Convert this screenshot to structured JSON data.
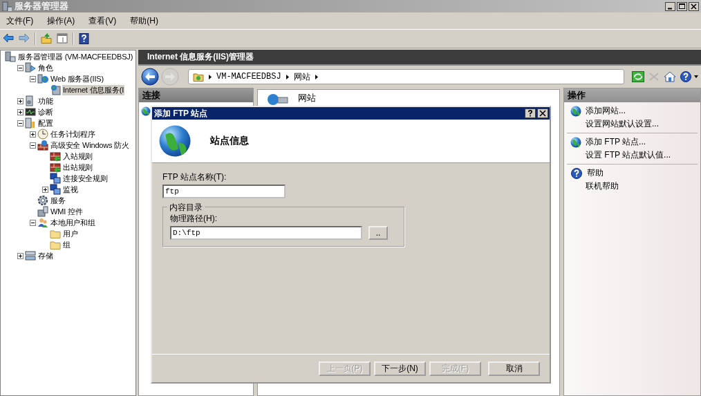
{
  "window": {
    "title": "服务器管理器"
  },
  "menu": [
    {
      "label": "文件(F)"
    },
    {
      "label": "操作(A)"
    },
    {
      "label": "查看(V)"
    },
    {
      "label": "帮助(H)"
    }
  ],
  "toolbar": [
    {
      "kind": "back",
      "disabled": false
    },
    {
      "kind": "forward",
      "disabled": true
    },
    {
      "kind": "up",
      "disabled": false
    },
    {
      "kind": "panel",
      "disabled": false
    },
    {
      "kind": "help",
      "disabled": false
    }
  ],
  "tree": [
    {
      "label": "服务器管理器 (VM-MACFEEDBSJ)",
      "kind": "server",
      "selected": false,
      "children": [
        {
          "label": "角色",
          "kind": "roles",
          "expanded": true,
          "selected": false,
          "children": [
            {
              "label": "Web 服务器(IIS)",
              "kind": "web",
              "expanded": true,
              "selected": false,
              "children": [
                {
                  "label": "Internet 信息服务(I",
                  "kind": "iis",
                  "selected": true
                }
              ]
            }
          ]
        },
        {
          "label": "功能",
          "kind": "features",
          "expanded": false,
          "selected": false
        },
        {
          "label": "诊断",
          "kind": "diagnostics",
          "expanded": false,
          "selected": false
        },
        {
          "label": "配置",
          "kind": "config",
          "expanded": true,
          "selected": false,
          "children": [
            {
              "label": "任务计划程序",
              "kind": "clock",
              "expanded": false,
              "selected": false
            },
            {
              "label": "高级安全 Windows 防火",
              "kind": "firewall",
              "expanded": true,
              "selected": false,
              "children": [
                {
                  "label": "入站规则",
                  "kind": "rule",
                  "selected": false
                },
                {
                  "label": "出站规则",
                  "kind": "rule",
                  "selected": false
                },
                {
                  "label": "连接安全规则",
                  "kind": "monitor",
                  "selected": false
                },
                {
                  "label": "监视",
                  "kind": "monitor",
                  "expanded": false,
                  "selected": false
                }
              ]
            },
            {
              "label": "服务",
              "kind": "services",
              "selected": false
            },
            {
              "label": "WMI 控件",
              "kind": "wmi",
              "selected": false
            },
            {
              "label": "本地用户和组",
              "kind": "users",
              "expanded": true,
              "selected": false,
              "children": [
                {
                  "label": "用户",
                  "kind": "folder",
                  "selected": false
                },
                {
                  "label": "组",
                  "kind": "folder",
                  "selected": false
                }
              ]
            }
          ]
        },
        {
          "label": "存储",
          "kind": "storage",
          "expanded": false,
          "selected": false
        }
      ]
    }
  ],
  "iis": {
    "title": "Internet 信息服务(IIS)管理器",
    "breadcrumb": [
      "VM-MACFEEDBSJ",
      "网站"
    ],
    "nav_tools": [
      {
        "kind": "refresh",
        "disabled": false
      },
      {
        "kind": "stop",
        "disabled": true
      },
      {
        "kind": "home",
        "disabled": false
      },
      {
        "kind": "help",
        "disabled": false
      }
    ],
    "connections": {
      "title": "连接"
    },
    "content": {
      "title": "网站"
    },
    "actions": {
      "title": "操作",
      "groups": [
        [
          {
            "label": "添加网站...",
            "kind": "globe"
          },
          {
            "label": "设置网站默认设置...",
            "kind": "plain"
          }
        ],
        [
          {
            "label": "添加 FTP 站点...",
            "kind": "globe"
          },
          {
            "label": "设置 FTP 站点默认值...",
            "kind": "plain"
          }
        ],
        [
          {
            "label": "帮助",
            "kind": "help"
          },
          {
            "label": "联机帮助",
            "kind": "plain"
          }
        ]
      ]
    }
  },
  "dialog": {
    "title": "添加 FTP 站点",
    "heading": "站点信息",
    "site_name": {
      "label": "FTP 站点名称(T):",
      "value": "ftp"
    },
    "content_dir": {
      "legend": "内容目录",
      "path_label": "物理路径(H):",
      "path_value": "D:\\ftp",
      "browse": ".."
    },
    "buttons": [
      {
        "label": "上一页(P)",
        "disabled": true
      },
      {
        "label": "下一步(N)",
        "disabled": false
      },
      {
        "label": "完成(F)",
        "disabled": true
      },
      {
        "label": "取消",
        "disabled": false
      }
    ]
  }
}
